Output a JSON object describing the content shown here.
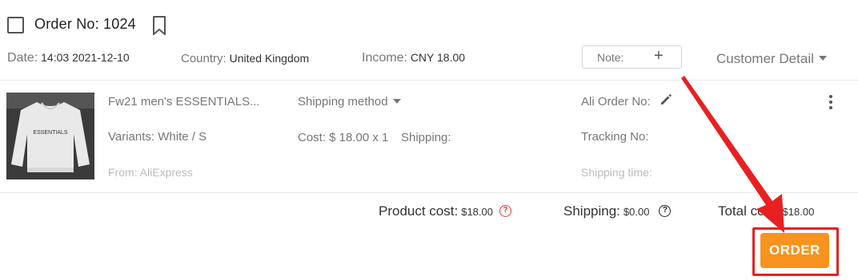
{
  "order": {
    "title": "Order No: 1024",
    "date_label": "Date:",
    "date_value": "14:03 2021-12-10",
    "country_label": "Country:",
    "country_value": "United Kingdom",
    "income_label": "Income:",
    "income_value": "CNY 18.00",
    "note_label": "Note:",
    "note_add": "+",
    "customer_detail": "Customer Detail"
  },
  "product": {
    "name": "Fw21 men's ESSENTIALS...",
    "variants": "Variants: White / S",
    "from": "From: AliExpress",
    "image_print": "ESSENTIALS",
    "shipping_method": "Shipping method",
    "cost": "Cost: $ 18.00 x 1",
    "shipping": "Shipping:",
    "ali_order_no": "Ali Order No:",
    "tracking_no": "Tracking No:",
    "shipping_time": "Shipping time:"
  },
  "totals": {
    "product_cost_label": "Product cost:",
    "product_cost_value": "$18.00",
    "shipping_label": "Shipping:",
    "shipping_value": "$0.00",
    "total_label": "Total cost:",
    "total_value": "$18.00"
  },
  "actions": {
    "order_button": "ORDER"
  },
  "colors": {
    "accent_orange": "#f7931e",
    "highlight_red": "#e82020",
    "help_red": "#e53935"
  },
  "icons": [
    "checkbox",
    "bookmark-icon",
    "plus-icon",
    "caret-down-icon",
    "pencil-icon",
    "more-vertical-icon",
    "help-circle-icon",
    "annotation-arrow"
  ]
}
